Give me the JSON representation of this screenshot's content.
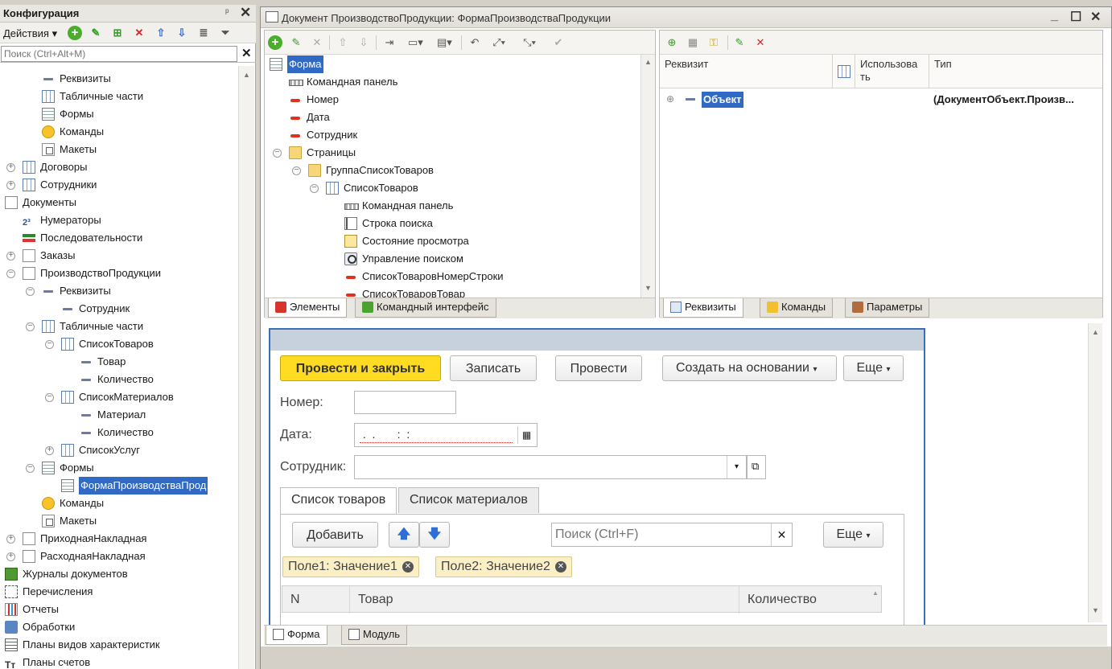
{
  "config_panel": {
    "title": "Конфигурация",
    "actions_label": "Действия",
    "search_placeholder": "Поиск (Ctrl+Alt+M)",
    "tree": [
      {
        "label": "Реквизиты",
        "icon": "attribute-icon"
      },
      {
        "label": "Табличные части",
        "icon": "table-icon"
      },
      {
        "label": "Формы",
        "icon": "form-icon"
      },
      {
        "label": "Команды",
        "icon": "command-icon"
      },
      {
        "label": "Макеты",
        "icon": "layout-icon"
      },
      {
        "label": "Договоры",
        "icon": "table-icon"
      },
      {
        "label": "Сотрудники",
        "icon": "table-icon"
      },
      {
        "label": "Документы",
        "icon": "document-icon"
      },
      {
        "label": "Нумераторы",
        "icon": "numerator-icon"
      },
      {
        "label": "Последовательности",
        "icon": "sequence-icon"
      },
      {
        "label": "Заказы",
        "icon": "document-icon"
      },
      {
        "label": "ПроизводствоПродукции",
        "icon": "document-icon"
      },
      {
        "label": "Реквизиты",
        "icon": "attribute-icon"
      },
      {
        "label": "Сотрудник",
        "icon": "attribute-icon"
      },
      {
        "label": "Табличные части",
        "icon": "table-icon"
      },
      {
        "label": "СписокТоваров",
        "icon": "table-icon"
      },
      {
        "label": "Товар",
        "icon": "attribute-icon"
      },
      {
        "label": "Количество",
        "icon": "attribute-icon"
      },
      {
        "label": "СписокМатериалов",
        "icon": "table-icon"
      },
      {
        "label": "Материал",
        "icon": "attribute-icon"
      },
      {
        "label": "Количество",
        "icon": "attribute-icon"
      },
      {
        "label": "СписокУслуг",
        "icon": "table-icon"
      },
      {
        "label": "Формы",
        "icon": "form-icon"
      },
      {
        "label": "ФормаПроизводстваПрод",
        "icon": "form-icon"
      },
      {
        "label": "Команды",
        "icon": "command-icon"
      },
      {
        "label": "Макеты",
        "icon": "layout-icon"
      },
      {
        "label": "ПриходнаяНакладная",
        "icon": "document-icon"
      },
      {
        "label": "РасходнаяНакладная",
        "icon": "document-icon"
      },
      {
        "label": "Журналы документов",
        "icon": "journal-icon"
      },
      {
        "label": "Перечисления",
        "icon": "enum-icon"
      },
      {
        "label": "Отчеты",
        "icon": "report-icon"
      },
      {
        "label": "Обработки",
        "icon": "processing-icon"
      },
      {
        "label": "Планы видов характеристик",
        "icon": "characteristics-icon"
      },
      {
        "label": "Планы счетов",
        "icon": "accounts-icon"
      }
    ]
  },
  "window": {
    "title": "Документ ПроизводствоПродукции: ФормаПроизводстваПродукции"
  },
  "elements_tree": [
    {
      "label": "Форма"
    },
    {
      "label": "Командная панель"
    },
    {
      "label": "Номер"
    },
    {
      "label": "Дата"
    },
    {
      "label": "Сотрудник"
    },
    {
      "label": "Страницы"
    },
    {
      "label": "ГруппаСписокТоваров"
    },
    {
      "label": "СписокТоваров"
    },
    {
      "label": "Командная панель"
    },
    {
      "label": "Строка поиска"
    },
    {
      "label": "Состояние просмотра"
    },
    {
      "label": "Управление поиском"
    },
    {
      "label": "СписокТоваровНомерСтроки"
    },
    {
      "label": "СписокТоваровТовар"
    }
  ],
  "left_tabs": {
    "elements": "Элементы",
    "command_interface": "Командный интерфейс"
  },
  "attributes_grid": {
    "col_attr": "Реквизит",
    "col_use": "Использова ть",
    "col_type": "Тип",
    "row_name": "Объект",
    "row_type": "(ДокументОбъект.Произв..."
  },
  "right_tabs": {
    "attributes": "Реквизиты",
    "commands": "Команды",
    "parameters": "Параметры"
  },
  "form_preview": {
    "btn_post_close": "Провести и закрыть",
    "btn_write": "Записать",
    "btn_post": "Провести",
    "btn_create_based": "Создать на основании",
    "btn_more": "Еще",
    "label_number": "Номер:",
    "label_date": "Дата:",
    "date_mask": " .  .       :  :",
    "label_employee": "Сотрудник:",
    "tab_goods": "Список товаров",
    "tab_materials": "Список материалов",
    "btn_add": "Добавить",
    "search_placeholder": "Поиск (Ctrl+F)",
    "btn_more2": "Еще",
    "chip1": "Поле1: Значение1",
    "chip2": "Поле2: Значение2",
    "col_n": "N",
    "col_goods": "Товар",
    "col_qty": "Количество"
  },
  "bottom_tabs": {
    "form": "Форма",
    "module": "Модуль"
  }
}
